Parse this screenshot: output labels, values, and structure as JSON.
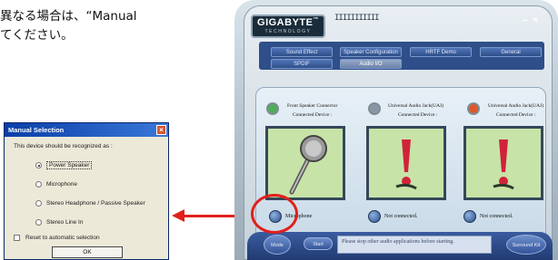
{
  "manual": {
    "line1": "異なる場合は、“Manual",
    "line2": "てください。"
  },
  "dialog": {
    "title": "Manual Selection",
    "close": "×",
    "prompt": "This device should be recognized as :",
    "options": [
      "Power Speaker",
      "Microphone",
      "Stereo Headphone / Passive Speaker",
      "Stereo Line In"
    ],
    "selected": "Power Speaker",
    "reset_label": "Reset to automatic selection",
    "ok": "OK"
  },
  "panel": {
    "logo": "GIGABYTE",
    "logo_tm": "™",
    "logo_sub": "TECHNOLOGY",
    "ticks": "IIIIIIIIIII",
    "minimize": "–",
    "close": "×",
    "tabs_row1": [
      "Sound Effect",
      "Speaker Configuration",
      "HRTF Demo",
      "General"
    ],
    "tabs_row2": [
      "SPDIF",
      "Audio I/O"
    ],
    "active_tab": "Audio I/O",
    "slots": [
      {
        "title": "Front Speaker Connector",
        "sub": "Connected Device :",
        "status": "Microphone",
        "jack_color": "#4fae5a"
      },
      {
        "title": "Universal Audio Jack(UAJ)",
        "sub": "Connected Device :",
        "status": "Not connected.",
        "jack_color": "#8a96a3"
      },
      {
        "title": "Universal Audio Jack(UAJ)",
        "sub": "Connected Device :",
        "status": "Not connected.",
        "jack_color": "#e0582a"
      }
    ],
    "bottom": {
      "btn1": "Mode",
      "btn2": "Start",
      "message": "Please stop other audio applications before starting.",
      "btn3": "Surround Kit"
    }
  },
  "colors": {
    "annotation_red": "#e0201c",
    "screen_green": "#c7e3a8",
    "tab_blue": "#2f4f8a"
  }
}
